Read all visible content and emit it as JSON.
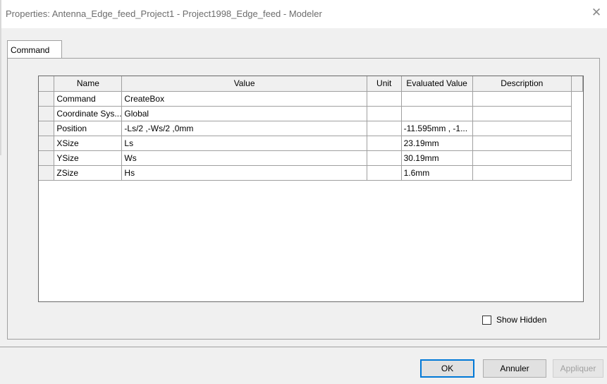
{
  "window": {
    "title": "Properties: Antenna_Edge_feed_Project1 - Project1998_Edge_feed - Modeler",
    "close_glyph": "✕"
  },
  "tabs": [
    {
      "label": "Command",
      "selected": true
    }
  ],
  "grid": {
    "columns": [
      "Name",
      "Value",
      "Unit",
      "Evaluated Value",
      "Description"
    ],
    "rows": [
      {
        "name": "Command",
        "value": "CreateBox",
        "unit": "",
        "evaluated": "",
        "description": ""
      },
      {
        "name": "Coordinate Sys...",
        "value": "Global",
        "unit": "",
        "evaluated": "",
        "description": ""
      },
      {
        "name": "Position",
        "value": "-Ls/2 ,-Ws/2 ,0mm",
        "unit": "",
        "evaluated": "-11.595mm , -1...",
        "description": ""
      },
      {
        "name": "XSize",
        "value": "Ls",
        "unit": "",
        "evaluated": "23.19mm",
        "description": ""
      },
      {
        "name": "YSize",
        "value": "Ws",
        "unit": "",
        "evaluated": "30.19mm",
        "description": ""
      },
      {
        "name": "ZSize",
        "value": "Hs",
        "unit": "",
        "evaluated": "1.6mm",
        "description": ""
      }
    ]
  },
  "options": {
    "show_hidden_label": "Show Hidden",
    "show_hidden_checked": false
  },
  "buttons": {
    "ok": "OK",
    "cancel": "Annuler",
    "apply": "Appliquer"
  }
}
